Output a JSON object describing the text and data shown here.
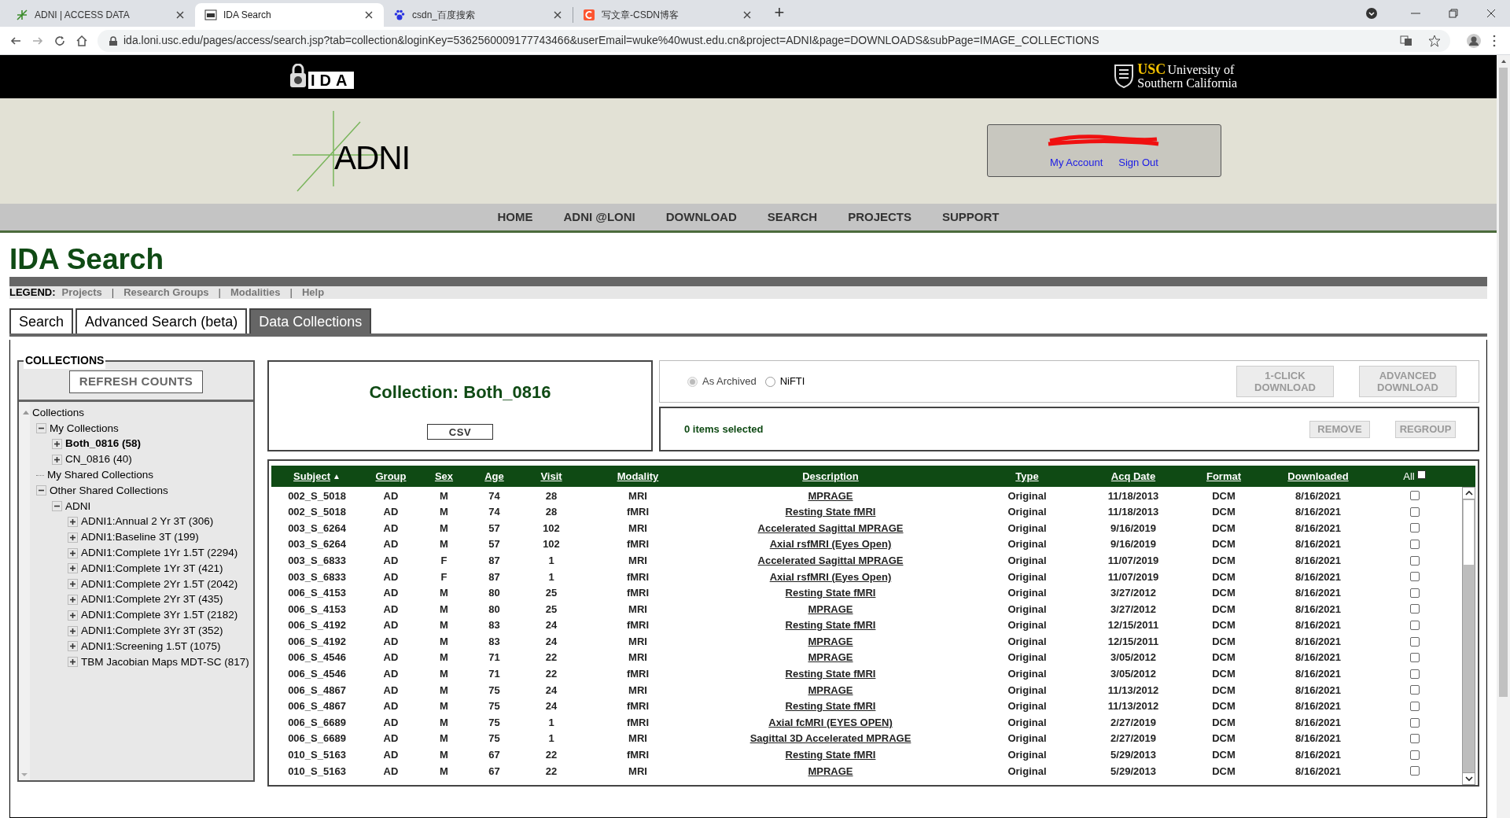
{
  "browser": {
    "tabs": [
      {
        "title": "ADNI |  ACCESS DATA",
        "selected": false,
        "kind": "adni"
      },
      {
        "title": "IDA Search",
        "selected": true,
        "kind": "ida"
      },
      {
        "title": "csdn_百度搜索",
        "selected": false,
        "kind": "paw"
      },
      {
        "title": "写文章-CSDN博客",
        "selected": false,
        "kind": "csdn"
      }
    ],
    "new_tab": "+",
    "url": "ida.loni.usc.edu/pages/access/search.jsp?tab=collection&loginKey=5362560009177743466&userEmail=wuke%40wust.edu.cn&project=ADNI&page=DOWNLOADS&subPage=IMAGE_COLLECTIONS"
  },
  "header": {
    "ida_logo": "IDA",
    "usc_logo": {
      "abbr": "USC",
      "line1": "University of",
      "line2": "Southern California"
    },
    "adni_logo": "ADNI",
    "account_links": [
      "My Account",
      "Sign Out"
    ]
  },
  "nav": [
    "HOME",
    "ADNI @LONI",
    "DOWNLOAD",
    "SEARCH",
    "PROJECTS",
    "SUPPORT"
  ],
  "page_title": "IDA Search",
  "legend": {
    "label": "LEGEND:",
    "items": [
      {
        "kind": "link",
        "text": "Projects"
      },
      {
        "kind": "separator",
        "text": "|"
      },
      {
        "kind": "link",
        "text": "Research Groups"
      },
      {
        "kind": "separator",
        "text": "|"
      },
      {
        "kind": "link",
        "text": "Modalities"
      },
      {
        "kind": "separator",
        "text": "|"
      },
      {
        "kind": "link",
        "text": "Help"
      }
    ]
  },
  "tabs": [
    {
      "label": "Search",
      "selected": false
    },
    {
      "label": "Advanced Search (beta)",
      "selected": false
    },
    {
      "label": "Data Collections",
      "selected": true
    }
  ],
  "collections_panel": {
    "title": "COLLECTIONS",
    "refresh_button": "REFRESH COUNTS",
    "tree": [
      {
        "label": "Collections",
        "kind": "root",
        "expanded": true,
        "selected": false,
        "children": [
          {
            "label": "My Collections",
            "kind": "folder",
            "expanded": true,
            "selected": false,
            "children": [
              {
                "label": "Both_0816 (58)",
                "kind": "folder",
                "expanded": false,
                "selected": true
              },
              {
                "label": "CN_0816 (40)",
                "kind": "folder",
                "expanded": false,
                "selected": false
              }
            ]
          },
          {
            "label": "My Shared Collections",
            "kind": "leaf",
            "selected": false
          },
          {
            "label": "Other Shared Collections",
            "kind": "folder",
            "expanded": true,
            "selected": false,
            "children": [
              {
                "label": "ADNI",
                "kind": "folder",
                "expanded": true,
                "selected": false,
                "children": [
                  {
                    "label": "ADNI1:Annual 2 Yr 3T (306)",
                    "kind": "folder",
                    "expanded": false,
                    "selected": false
                  },
                  {
                    "label": "ADNI1:Baseline 3T (199)",
                    "kind": "folder",
                    "expanded": false,
                    "selected": false
                  },
                  {
                    "label": "ADNI1:Complete 1Yr 1.5T (2294)",
                    "kind": "folder",
                    "expanded": false,
                    "selected": false
                  },
                  {
                    "label": "ADNI1:Complete 1Yr 3T (421)",
                    "kind": "folder",
                    "expanded": false,
                    "selected": false
                  },
                  {
                    "label": "ADNI1:Complete 2Yr 1.5T (2042)",
                    "kind": "folder",
                    "expanded": false,
                    "selected": false
                  },
                  {
                    "label": "ADNI1:Complete 2Yr 3T (435)",
                    "kind": "folder",
                    "expanded": false,
                    "selected": false
                  },
                  {
                    "label": "ADNI1:Complete 3Yr 1.5T (2182)",
                    "kind": "folder",
                    "expanded": false,
                    "selected": false
                  },
                  {
                    "label": "ADNI1:Complete 3Yr 3T (352)",
                    "kind": "folder",
                    "expanded": false,
                    "selected": false
                  },
                  {
                    "label": "ADNI1:Screening 1.5T (1075)",
                    "kind": "folder",
                    "expanded": false,
                    "selected": false
                  },
                  {
                    "label": "TBM Jacobian Maps MDT-SC (817)",
                    "kind": "folder",
                    "expanded": false,
                    "selected": false
                  }
                ]
              }
            ]
          }
        ]
      }
    ]
  },
  "collection": {
    "title": "Collection: Both_0816",
    "csv_button": "CSV"
  },
  "format_options": [
    {
      "label": "As Archived",
      "selected": true,
      "disabled": true
    },
    {
      "label": "NiFTI",
      "selected": false,
      "disabled": false
    }
  ],
  "download_buttons": [
    {
      "label": "1-CLICK DOWNLOAD",
      "disabled": true
    },
    {
      "label": "ADVANCED DOWNLOAD",
      "disabled": true
    }
  ],
  "selection": {
    "count_text": "0 items selected",
    "buttons": [
      {
        "label": "REMOVE",
        "disabled": true
      },
      {
        "label": "REGROUP",
        "disabled": true
      }
    ]
  },
  "table": {
    "columns": [
      {
        "label": "Subject",
        "sort": "▲"
      },
      {
        "label": "Group"
      },
      {
        "label": "Sex"
      },
      {
        "label": "Age"
      },
      {
        "label": "Visit"
      },
      {
        "label": "Modality"
      },
      {
        "label": "Description"
      },
      {
        "label": "Type"
      },
      {
        "label": "Acq Date"
      },
      {
        "label": "Format"
      },
      {
        "label": "Downloaded"
      },
      {
        "label": "All",
        "kind": "select_all",
        "checked": false
      }
    ],
    "rows": [
      {
        "cells": [
          "002_S_5018",
          "AD",
          "M",
          "74",
          "28",
          "MRI",
          "MPRAGE",
          "Original",
          "11/18/2013",
          "DCM",
          "8/16/2021"
        ],
        "checked": false
      },
      {
        "cells": [
          "002_S_5018",
          "AD",
          "M",
          "74",
          "28",
          "fMRI",
          "Resting State fMRI",
          "Original",
          "11/18/2013",
          "DCM",
          "8/16/2021"
        ],
        "checked": false
      },
      {
        "cells": [
          "003_S_6264",
          "AD",
          "M",
          "57",
          "102",
          "MRI",
          "Accelerated Sagittal MPRAGE",
          "Original",
          "9/16/2019",
          "DCM",
          "8/16/2021"
        ],
        "checked": false
      },
      {
        "cells": [
          "003_S_6264",
          "AD",
          "M",
          "57",
          "102",
          "fMRI",
          "Axial rsfMRI (Eyes Open)",
          "Original",
          "9/16/2019",
          "DCM",
          "8/16/2021"
        ],
        "checked": false
      },
      {
        "cells": [
          "003_S_6833",
          "AD",
          "F",
          "87",
          "1",
          "MRI",
          "Accelerated Sagittal MPRAGE",
          "Original",
          "11/07/2019",
          "DCM",
          "8/16/2021"
        ],
        "checked": false
      },
      {
        "cells": [
          "003_S_6833",
          "AD",
          "F",
          "87",
          "1",
          "fMRI",
          "Axial rsfMRI (Eyes Open)",
          "Original",
          "11/07/2019",
          "DCM",
          "8/16/2021"
        ],
        "checked": false
      },
      {
        "cells": [
          "006_S_4153",
          "AD",
          "M",
          "80",
          "25",
          "fMRI",
          "Resting State fMRI",
          "Original",
          "3/27/2012",
          "DCM",
          "8/16/2021"
        ],
        "checked": false
      },
      {
        "cells": [
          "006_S_4153",
          "AD",
          "M",
          "80",
          "25",
          "MRI",
          "MPRAGE",
          "Original",
          "3/27/2012",
          "DCM",
          "8/16/2021"
        ],
        "checked": false
      },
      {
        "cells": [
          "006_S_4192",
          "AD",
          "M",
          "83",
          "24",
          "fMRI",
          "Resting State fMRI",
          "Original",
          "12/15/2011",
          "DCM",
          "8/16/2021"
        ],
        "checked": false
      },
      {
        "cells": [
          "006_S_4192",
          "AD",
          "M",
          "83",
          "24",
          "MRI",
          "MPRAGE",
          "Original",
          "12/15/2011",
          "DCM",
          "8/16/2021"
        ],
        "checked": false
      },
      {
        "cells": [
          "006_S_4546",
          "AD",
          "M",
          "71",
          "22",
          "MRI",
          "MPRAGE",
          "Original",
          "3/05/2012",
          "DCM",
          "8/16/2021"
        ],
        "checked": false
      },
      {
        "cells": [
          "006_S_4546",
          "AD",
          "M",
          "71",
          "22",
          "fMRI",
          "Resting State fMRI",
          "Original",
          "3/05/2012",
          "DCM",
          "8/16/2021"
        ],
        "checked": false
      },
      {
        "cells": [
          "006_S_4867",
          "AD",
          "M",
          "75",
          "24",
          "MRI",
          "MPRAGE",
          "Original",
          "11/13/2012",
          "DCM",
          "8/16/2021"
        ],
        "checked": false
      },
      {
        "cells": [
          "006_S_4867",
          "AD",
          "M",
          "75",
          "24",
          "fMRI",
          "Resting State fMRI",
          "Original",
          "11/13/2012",
          "DCM",
          "8/16/2021"
        ],
        "checked": false
      },
      {
        "cells": [
          "006_S_6689",
          "AD",
          "M",
          "75",
          "1",
          "fMRI",
          "Axial fcMRI (EYES OPEN)",
          "Original",
          "2/27/2019",
          "DCM",
          "8/16/2021"
        ],
        "checked": false
      },
      {
        "cells": [
          "006_S_6689",
          "AD",
          "M",
          "75",
          "1",
          "MRI",
          "Sagittal 3D Accelerated MPRAGE",
          "Original",
          "2/27/2019",
          "DCM",
          "8/16/2021"
        ],
        "checked": false
      },
      {
        "cells": [
          "010_S_5163",
          "AD",
          "M",
          "67",
          "22",
          "fMRI",
          "Resting State fMRI",
          "Original",
          "5/29/2013",
          "DCM",
          "8/16/2021"
        ],
        "checked": false
      },
      {
        "cells": [
          "010_S_5163",
          "AD",
          "M",
          "67",
          "22",
          "MRI",
          "MPRAGE",
          "Original",
          "5/29/2013",
          "DCM",
          "8/16/2021"
        ],
        "checked": false
      }
    ]
  }
}
